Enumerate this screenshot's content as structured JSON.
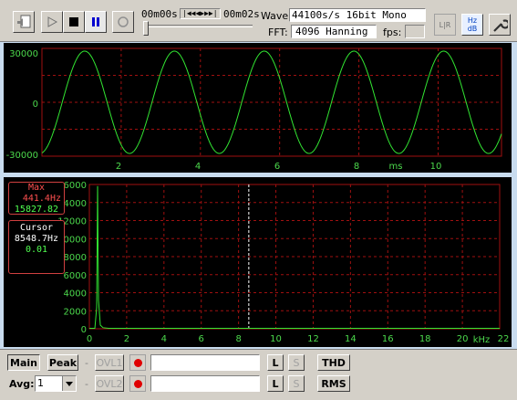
{
  "toolbar": {
    "time_start": "00m00s",
    "time_end": "00m02s",
    "seek_symbols": "|◀◀◀▶▶▶|",
    "wave_label": "Wave:",
    "wave_value": "44100s/s 16bit Mono",
    "fft_label": "FFT:",
    "fft_value": "4096 Hanning",
    "fps_label": "fps:",
    "fps_value": "",
    "lr_label": "L|R",
    "hz_label": "Hz",
    "db_label": "dB",
    "playback_position": 0.0
  },
  "waveform": {
    "y_ticks": [
      "30000",
      "0",
      "-30000"
    ],
    "x_ticks": [
      "2",
      "4",
      "6",
      "8",
      "10"
    ],
    "x_unit": "ms",
    "trace_color": "#32e632",
    "grid_color": "#a01010"
  },
  "spectrum": {
    "y_ticks": [
      "16000",
      "14000",
      "12000",
      "10000",
      "8000",
      "6000",
      "4000",
      "2000",
      "0"
    ],
    "x_ticks": [
      "0",
      "2",
      "4",
      "6",
      "8",
      "10",
      "12",
      "14",
      "16",
      "18",
      "20",
      "22"
    ],
    "x_unit": "kHz",
    "cursor_khz": 8.5487,
    "peak_khz": 0.4414,
    "peak_value": 15827.82
  },
  "max_box": {
    "title": "Max",
    "freq": "441.4Hz",
    "value": "15827.82"
  },
  "cursor_box": {
    "title": "Cursor",
    "freq": "8548.7Hz",
    "value": "0.01"
  },
  "bottom": {
    "main_label": "Main",
    "peak_label": "Peak",
    "dash1": "-",
    "ovl1_label": "OVL1",
    "avg_label": "Avg:",
    "avg_value": "1",
    "dash2": "-",
    "ovl2_label": "OVL2",
    "l_label": "L",
    "s_label": "S",
    "thd_label": "THD",
    "rms_label": "RMS",
    "field1_value": "",
    "field2_value": ""
  },
  "colors": {
    "trace": "#32e632",
    "axis_text": "#4cd94c",
    "grid": "#a01010",
    "box_border": "#d04040",
    "max_text": "#ff5050",
    "max_value_text": "#50ff50",
    "cursor_text": "#ffffff",
    "cursor_value": "#50ff50",
    "record": "#e00000",
    "pause": "#0000d0"
  }
}
